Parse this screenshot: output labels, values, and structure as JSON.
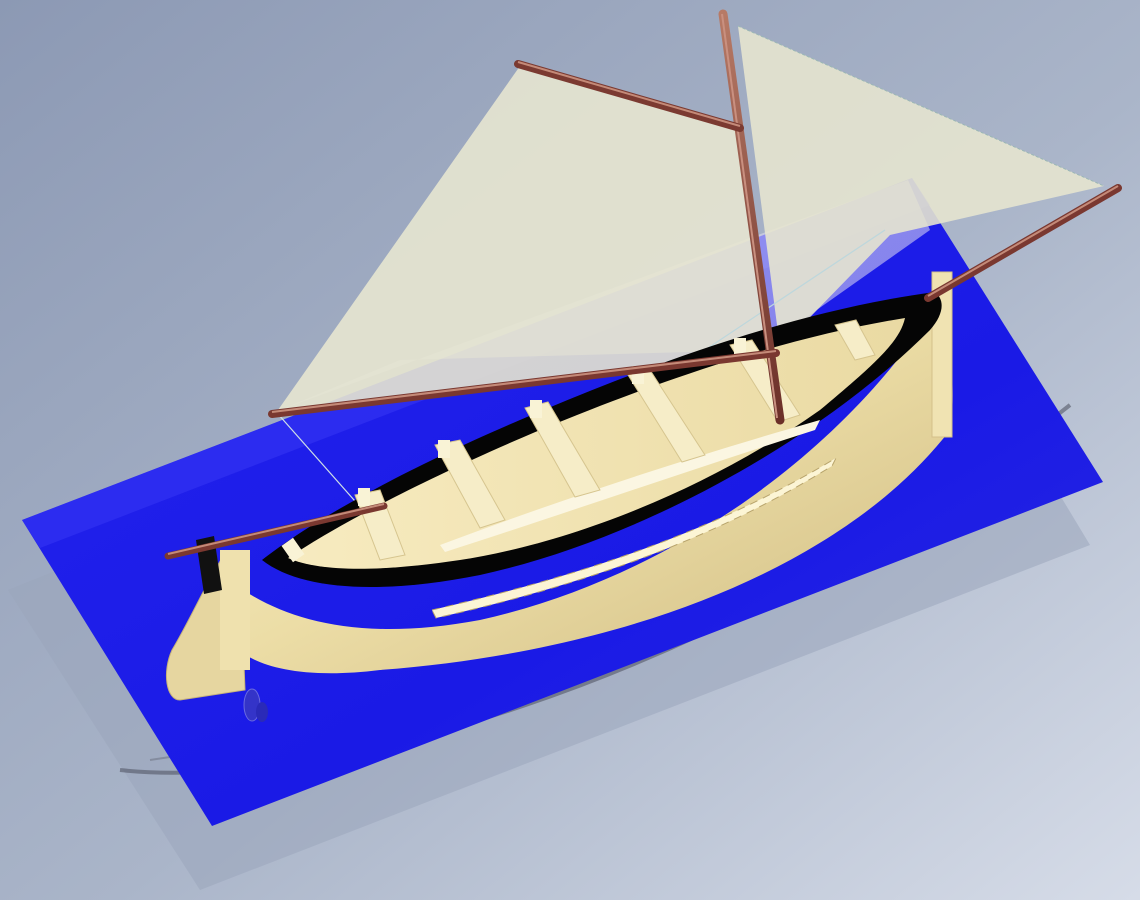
{
  "scene": {
    "description_visible_text": "",
    "colors": {
      "background_top": "#8e9cb6",
      "background_bottom": "#d4dae6",
      "water": "#1f1ff0",
      "hull": "#e9dba8",
      "interior": "#f3e6b8",
      "gunwale": "#000000",
      "sail": "#e8e6d2",
      "spar": "#7a3b32",
      "thwart": "#f6efcb"
    }
  }
}
